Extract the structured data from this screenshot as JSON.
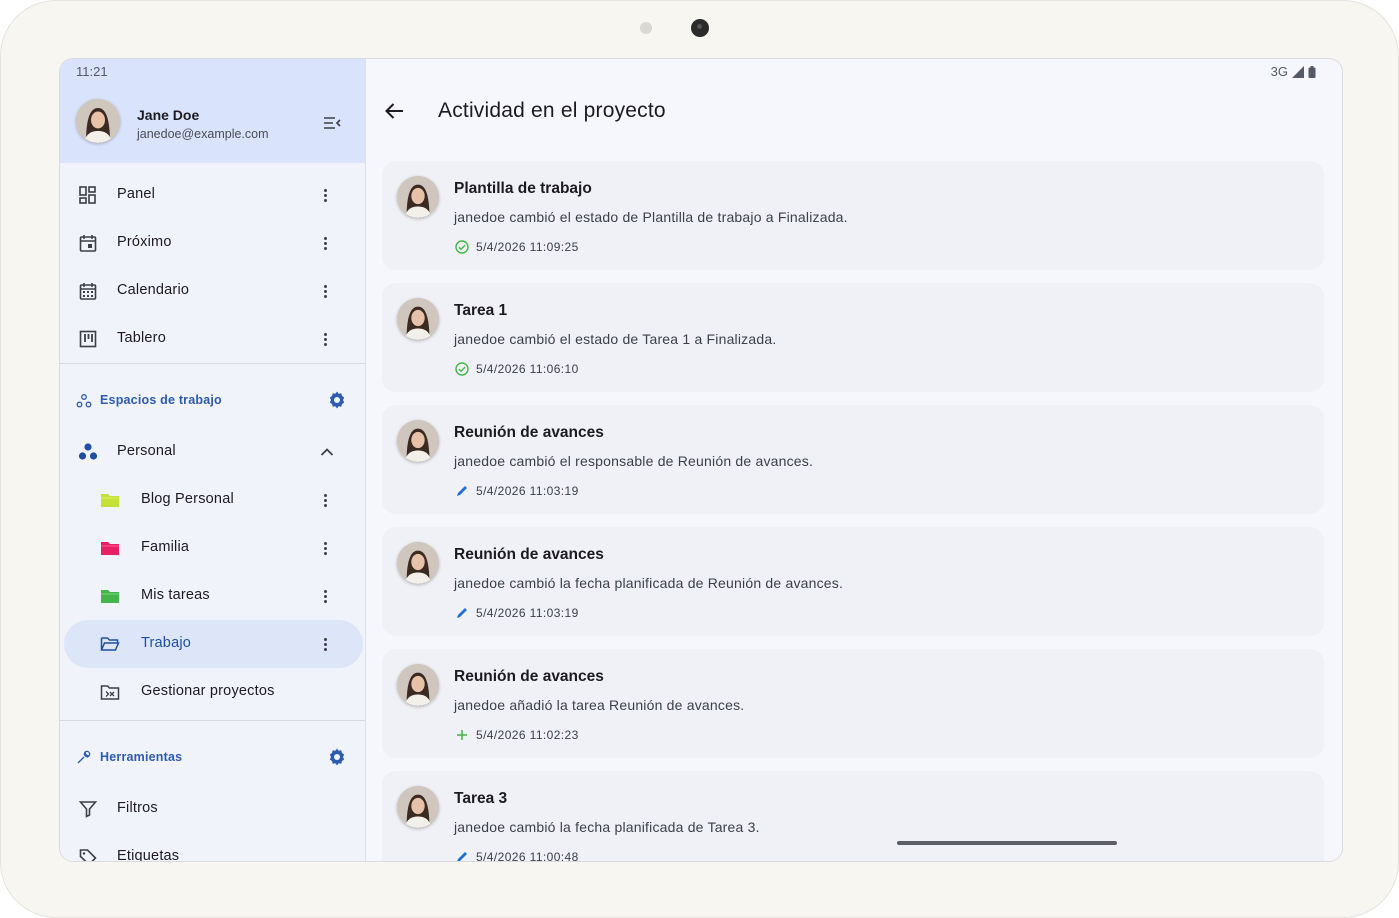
{
  "status": {
    "time": "11:21",
    "network": "3G"
  },
  "user": {
    "name": "Jane Doe",
    "email": "janedoe@example.com"
  },
  "nav": {
    "panel": "Panel",
    "proximo": "Próximo",
    "calendario": "Calendario",
    "tablero": "Tablero"
  },
  "workspaces": {
    "title": "Espacios de trabajo",
    "group": "Personal",
    "items": [
      {
        "label": "Blog Personal",
        "color": "#c6e03a"
      },
      {
        "label": "Familia",
        "color": "#e91e63"
      },
      {
        "label": "Mis tareas",
        "color": "#43b649"
      },
      {
        "label": "Trabajo",
        "color": "#1f4fa3"
      }
    ],
    "manage": "Gestionar proyectos"
  },
  "tools": {
    "title": "Herramientas",
    "filters": "Filtros",
    "labels": "Etiquetas"
  },
  "main": {
    "title": "Actividad en el proyecto",
    "activities": [
      {
        "title": "Plantilla de trabajo",
        "desc": "janedoe cambió el estado de Plantilla de trabajo a Finalizada.",
        "time": "5/4/2026 11:09:25",
        "icon": "check-circle-icon"
      },
      {
        "title": "Tarea 1",
        "desc": "janedoe cambió el estado de Tarea 1 a Finalizada.",
        "time": "5/4/2026 11:06:10",
        "icon": "check-circle-icon"
      },
      {
        "title": "Reunión de avances",
        "desc": "janedoe cambió el responsable de Reunión de avances.",
        "time": "5/4/2026 11:03:19",
        "icon": "pencil-icon"
      },
      {
        "title": "Reunión de avances",
        "desc": "janedoe cambió la fecha planificada de Reunión de avances.",
        "time": "5/4/2026 11:03:19",
        "icon": "pencil-icon"
      },
      {
        "title": "Reunión de avances",
        "desc": "janedoe añadió la tarea Reunión de avances.",
        "time": "5/4/2026 11:02:23",
        "icon": "plus-icon"
      },
      {
        "title": "Tarea 3",
        "desc": "janedoe cambió la fecha planificada de Tarea 3.",
        "time": "5/4/2026 11:00:48",
        "icon": "pencil-icon"
      }
    ]
  },
  "colors": {
    "accent": "#1f4fa3",
    "success": "#43b649",
    "edit": "#1e6fd0",
    "header_bg": "#d9e3fb"
  }
}
